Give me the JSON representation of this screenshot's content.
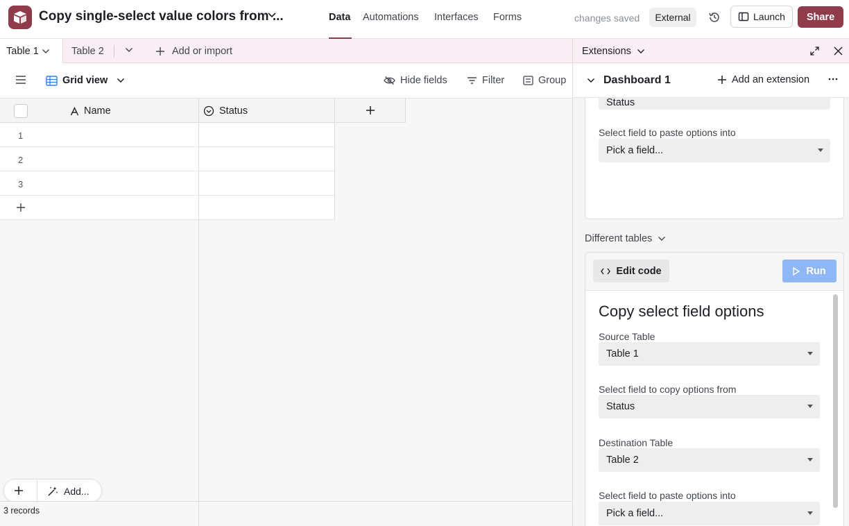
{
  "topbar": {
    "base_title": "Copy single-select value colors from ...",
    "nav": [
      "Data",
      "Automations",
      "Interfaces",
      "Forms"
    ],
    "saved_status": "changes saved",
    "external_label": "External",
    "launch_label": "Launch",
    "share_label": "Share",
    "colors": {
      "brand": "#8f3b49"
    }
  },
  "tabs": {
    "table1": "Table 1",
    "table2": "Table 2",
    "add_import": "Add or import"
  },
  "viewbar": {
    "view_name": "Grid view",
    "hide_fields": "Hide fields",
    "filter": "Filter",
    "group": "Group"
  },
  "grid": {
    "columns": [
      "Name",
      "Status"
    ],
    "rows": [
      "1",
      "2",
      "3"
    ],
    "add_label": "Add...",
    "records_count": "3 records"
  },
  "extensions": {
    "title": "Extensions",
    "dashboard": "Dashboard 1",
    "add_extension": "Add an extension",
    "top_card": {
      "partial_value": "Status",
      "paste_label": "Select field to paste options into",
      "paste_value": "Pick a field..."
    },
    "section_label": "Different tables",
    "main_card": {
      "edit_code": "Edit code",
      "run": "Run",
      "heading": "Copy select field options",
      "source_table_label": "Source Table",
      "source_table_value": "Table 1",
      "copy_from_label": "Select field to copy options from",
      "copy_from_value": "Status",
      "dest_table_label": "Destination Table",
      "dest_table_value": "Table 2",
      "paste_label": "Select field to paste options into",
      "paste_value": "Pick a field..."
    }
  }
}
